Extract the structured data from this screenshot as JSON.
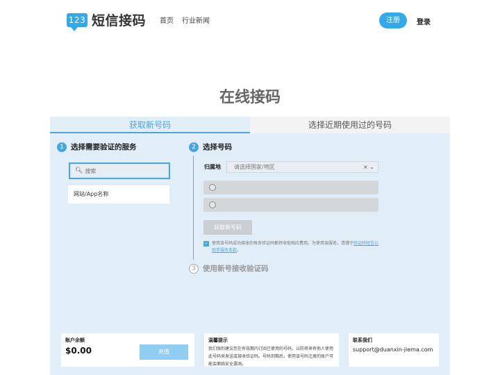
{
  "header": {
    "logo_badge": "123",
    "logo_text": "短信接码",
    "nav": [
      "首页",
      "行业新闻"
    ],
    "register": "注册",
    "login": "登录"
  },
  "page_title": "在线接码",
  "tabs": [
    "获取新号码",
    "选择近期使用过的号码"
  ],
  "step1": {
    "num": "1",
    "title": "选择需要验证的服务",
    "search_placeholder": "搜索",
    "service_item": "网站/App名称"
  },
  "step2": {
    "num": "2",
    "title": "选择号码",
    "region_label": "归属地",
    "region_placeholder": "请选择国家/地区",
    "select_controls": "× ⌄",
    "get_button": "获取新号码",
    "agree_text": "使用该号码成功接收的每条验证码都将收取相应费用。为使用该服务，请遵守",
    "agree_link": "验证码短信公助手服务条款",
    "agree_end": "。"
  },
  "step3": {
    "num": "3",
    "title": "使用新号接收验证码"
  },
  "cards": {
    "balance_title": "账户余额",
    "balance": "$0.00",
    "recharge": "充值",
    "tip_title": "温馨提示",
    "tip_text": "我们强烈建议您在有效期内订阅已使用的号码，以防将来有他人使用此号码来发送或接收验证码。号码到期后，使用该号码注册的账户可能会面临安全漏洞。",
    "contact_title": "联系我们",
    "contact_email": "support@duanxin-jiema.com"
  },
  "colors": {
    "accent": "#33a9e8",
    "panel_bg": "#e1eef7"
  }
}
